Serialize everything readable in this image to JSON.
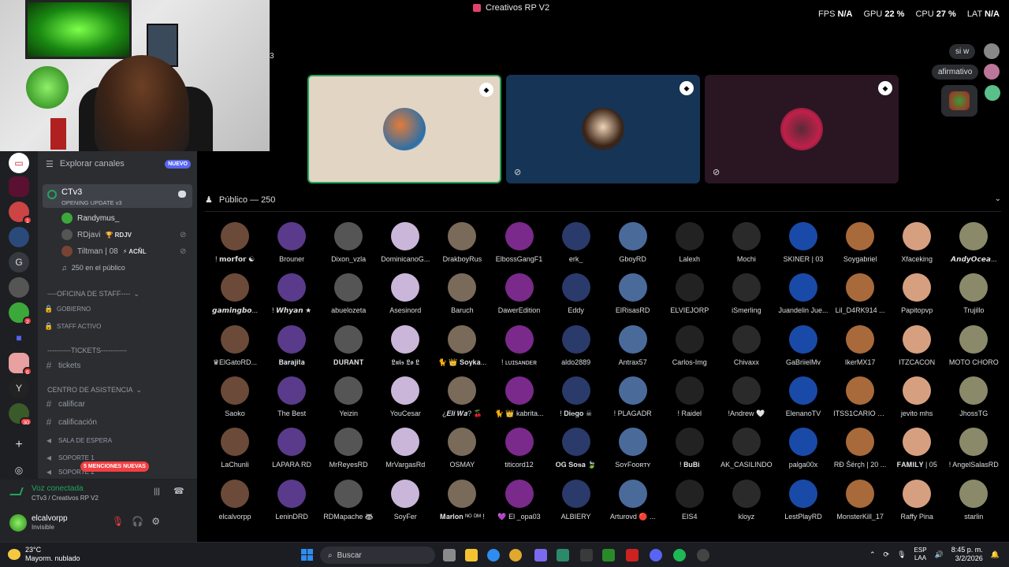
{
  "titlebar": {
    "title": "Creativos RP V2",
    "fps_label": "FPS",
    "fps_value": "N/A",
    "gpu_label": "GPU",
    "gpu_value": "22 %",
    "cpu_label": "CPU",
    "cpu_value": "27 %",
    "lat_label": "LAT",
    "lat_value": "N/A"
  },
  "stage": {
    "topic_suffix": "3"
  },
  "chat": {
    "msg1": "si w",
    "msg2": "afirmativo"
  },
  "channels": {
    "explore": "Explorar canales",
    "explore_badge": "NUEVO",
    "voice_channel": "CTv3",
    "voice_channel_sub": "OPENING UPDATE v3",
    "users": [
      {
        "name": "Randymus_",
        "tag": ""
      },
      {
        "name": "RDjavi",
        "tag": "🏆 RDJV"
      },
      {
        "name": "Tiltman | 08",
        "tag": "⚡ ACÑL"
      }
    ],
    "audience_summary": "250 en el público",
    "sections": [
      {
        "label": "----OFICINA DE STAFF----"
      },
      {
        "label": "----------TICKETS-----------"
      },
      {
        "label": "CENTRO DE ASISTENCIA"
      }
    ],
    "rows": [
      {
        "label": "GOBIERNO"
      },
      {
        "label": "STAFF ACTIVO"
      },
      {
        "label": "tickets"
      },
      {
        "label": "calificar"
      },
      {
        "label": "calificación"
      },
      {
        "label": "SALA DE ESPERA"
      },
      {
        "label": "SOPORTE 1"
      },
      {
        "label": "SOPORTE 2"
      }
    ],
    "mentions": "5 MENCIONES NUEVAS"
  },
  "voice_panel": {
    "status": "Voz conectada",
    "location": "CTv3 / Creativos RP V2"
  },
  "user": {
    "name": "elcalvorpp",
    "status": "Invisible"
  },
  "audience": {
    "title": "Público — 250",
    "members": [
      "! 𝗺𝗼𝗿𝗳𝗼𝗿 ☯",
      "Brouner",
      "Dixon_vzla",
      "DominicanoG...",
      "DrakboyRus",
      "ElbossGangF1",
      "erk_",
      "GboyRD",
      "Lalexh",
      "Mochi",
      "SKINER | 03",
      "Soygabriel",
      "Xfaceking",
      "𝘼𝙣𝙙𝙮𝙊𝙘𝙚𝙖...",
      "𝙜𝙖𝙢𝙞𝙣𝙜𝙗𝙤...",
      "! 𝙒𝙝𝙮𝙖𝙣 ★",
      "abuelozeta",
      "Asesinord",
      "Baruch",
      "DawerEdition",
      "Eddy",
      "ElRisasRD",
      "ELVIEJORP",
      "iSmerling",
      "Juandelin Jue...",
      "Lil_D4RK914 ...",
      "Papitopvp",
      "Trujillo",
      "♛ElGatoRD...",
      "𝐁𝐚𝐫𝐚𝐣𝐢𝐭𝐚",
      "𝐃𝐔𝐑𝐀𝐍𝐓",
      "𝕷𝖚𝖎𝖘 𝕷𝖔 𝕷",
      "🐈 👑 𝐒𝐨𝐲𝐤𝐚...",
      "! ʟᴜɪsᴀɴᴅᴇʀ",
      "aldo2889",
      "Antrax57",
      "Carlos-Img",
      "Chivaxx",
      "GaBriielMv",
      "IkerMX17",
      "ITZCACON",
      "MOTO CHORO",
      "Saoko",
      "The Best",
      "Yeizin",
      "YouCesar",
      "¿𝑬𝒍𝒊 𝑾𝒂? 🍒",
      "🐈 👑 kabrita...",
      "! 𝐃𝐢𝐞𝐠𝐨 ☠",
      "! PLAGADR",
      "! Raidel",
      "!Andrew 🤍",
      "ElenanoTV",
      "ITSS1CARIO O...",
      "jevito mhs",
      "JhossTG",
      "LaChunli",
      "LAPARA RD",
      "MrReyesRD",
      "MrVargasRd",
      "OSMAY",
      "titicord12",
      "𝐎𝐆 𝐒𝐨𝐬𝐚 🍃",
      "SᴏʏFᴏᴏʀᴛʏ",
      "! 𝐁𝐮𝐁𝐢",
      "AK_CASILINDO",
      "palga00x",
      "RĐ Šërçh | 20 ...",
      "𝐅𝐀𝐌𝐈𝐋𝐘 | 05",
      "! AngelSalasRD",
      "elcalvorpp",
      "LeninDRD",
      "RDMapache 🦝",
      "SoyFer",
      "𝐌𝐚𝐫𝐥𝐨𝐧 ᴺᴼ ᴰᴹ !",
      "💜 El _opa03",
      "ALBIERY",
      "Arturovd 🔴 ...",
      "EIS4",
      "kloyz",
      "LestPlayRD",
      "MonsterKill_17",
      "Raffy Pina",
      "starlin"
    ]
  },
  "taskbar": {
    "temp": "23°C",
    "weather": "Mayorm. nublado",
    "search": "Buscar",
    "lang1": "ESP",
    "lang2": "LAA",
    "time": "8:45 p. m.",
    "date": "3/2/2026"
  },
  "colors": {
    "accent": "#5865f2",
    "online": "#23a55a",
    "danger": "#f23f43"
  }
}
